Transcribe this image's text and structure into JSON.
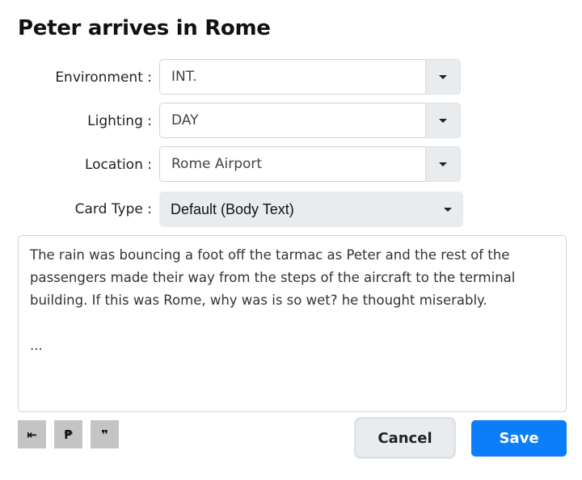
{
  "dialog": {
    "title": "Peter arrives in Rome"
  },
  "form": {
    "environment": {
      "label": "Environment :",
      "value": "INT."
    },
    "lighting": {
      "label": "Lighting :",
      "value": "DAY"
    },
    "location": {
      "label": "Location :",
      "value": "Rome Airport"
    },
    "card_type": {
      "label": "Card Type :",
      "value": "Default (Body Text)"
    },
    "body_text": "The rain was bouncing a foot off the tarmac as Peter and the rest of the passengers made their way from the steps of the aircraft to the terminal building. If this was Rome, why was is so wet? he thought miserably.\n\n..."
  },
  "toolbar": {
    "indent_icon": "⇤",
    "paragraph_icon": "₱",
    "quote_icon": "❞"
  },
  "actions": {
    "cancel_label": "Cancel",
    "save_label": "Save"
  },
  "colors": {
    "primary": "#0d7ef9",
    "secondary_bg": "#e9ecef",
    "tool_bg": "#c4c4c4"
  }
}
